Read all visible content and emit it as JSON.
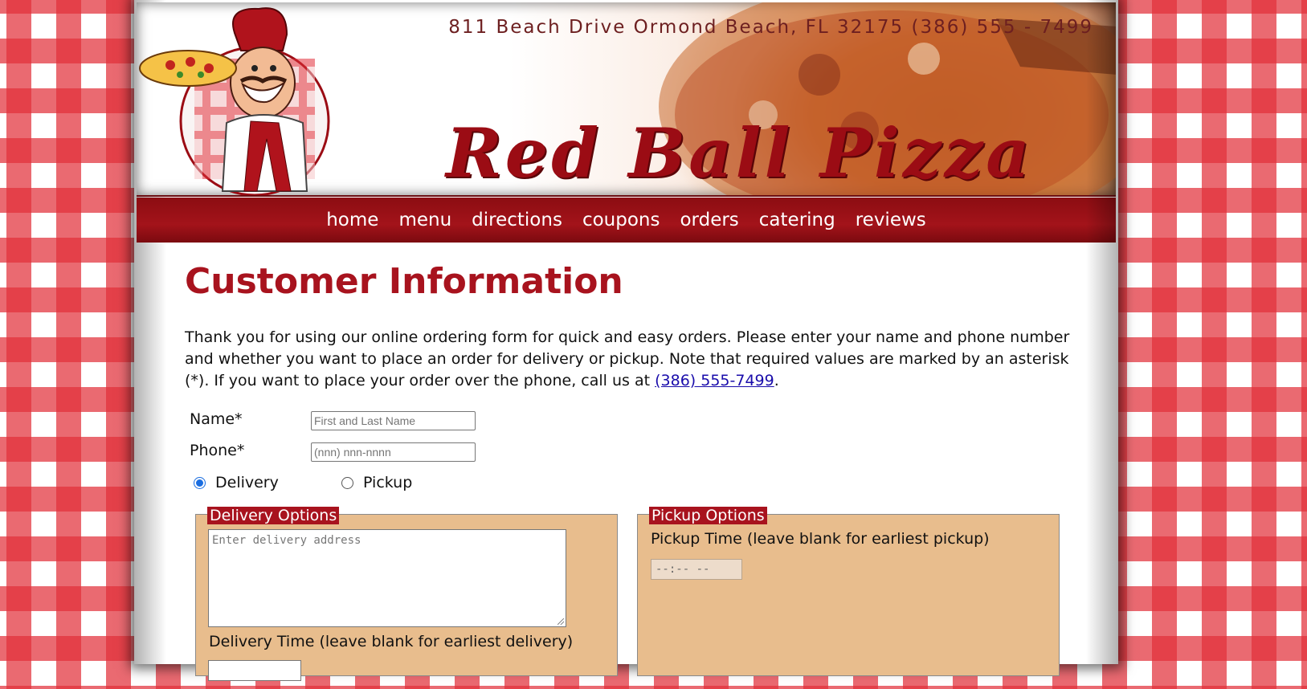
{
  "header": {
    "address": "811 Beach Drive  Ormond Beach, FL 32175   (386) 555 - 7499",
    "brand": "Red Ball Pizza"
  },
  "nav": [
    "home",
    "menu",
    "directions",
    "coupons",
    "orders",
    "catering",
    "reviews"
  ],
  "main": {
    "title": "Customer Information",
    "intro": "Thank you for using our online ordering form for quick and easy orders. Please enter your name and phone number and whether you want to place an order for delivery or pickup. Note that required values are marked by an asterisk (*). If you want to place your order over the phone, call us at ",
    "intro_phone": "(386) 555-7499",
    "intro_end": "."
  },
  "form": {
    "name_label": "Name*",
    "name_placeholder": "First and Last Name",
    "phone_label": "Phone*",
    "phone_placeholder": "(nnn) nnn-nnnn",
    "delivery_radio": "Delivery",
    "pickup_radio": "Pickup",
    "selected": "Delivery"
  },
  "delivery": {
    "legend": "Delivery Options",
    "address_placeholder": "Enter delivery address",
    "time_label": "Delivery Time (leave blank for earliest delivery)"
  },
  "pickup": {
    "legend": "Pickup Options",
    "time_label": "Pickup Time (leave blank for earliest pickup)",
    "time_placeholder": "--:-- --"
  },
  "colors": {
    "brand_red": "#a8131e",
    "fieldset_bg": "#e8bd8d",
    "nav_bg": "#a3131a"
  }
}
